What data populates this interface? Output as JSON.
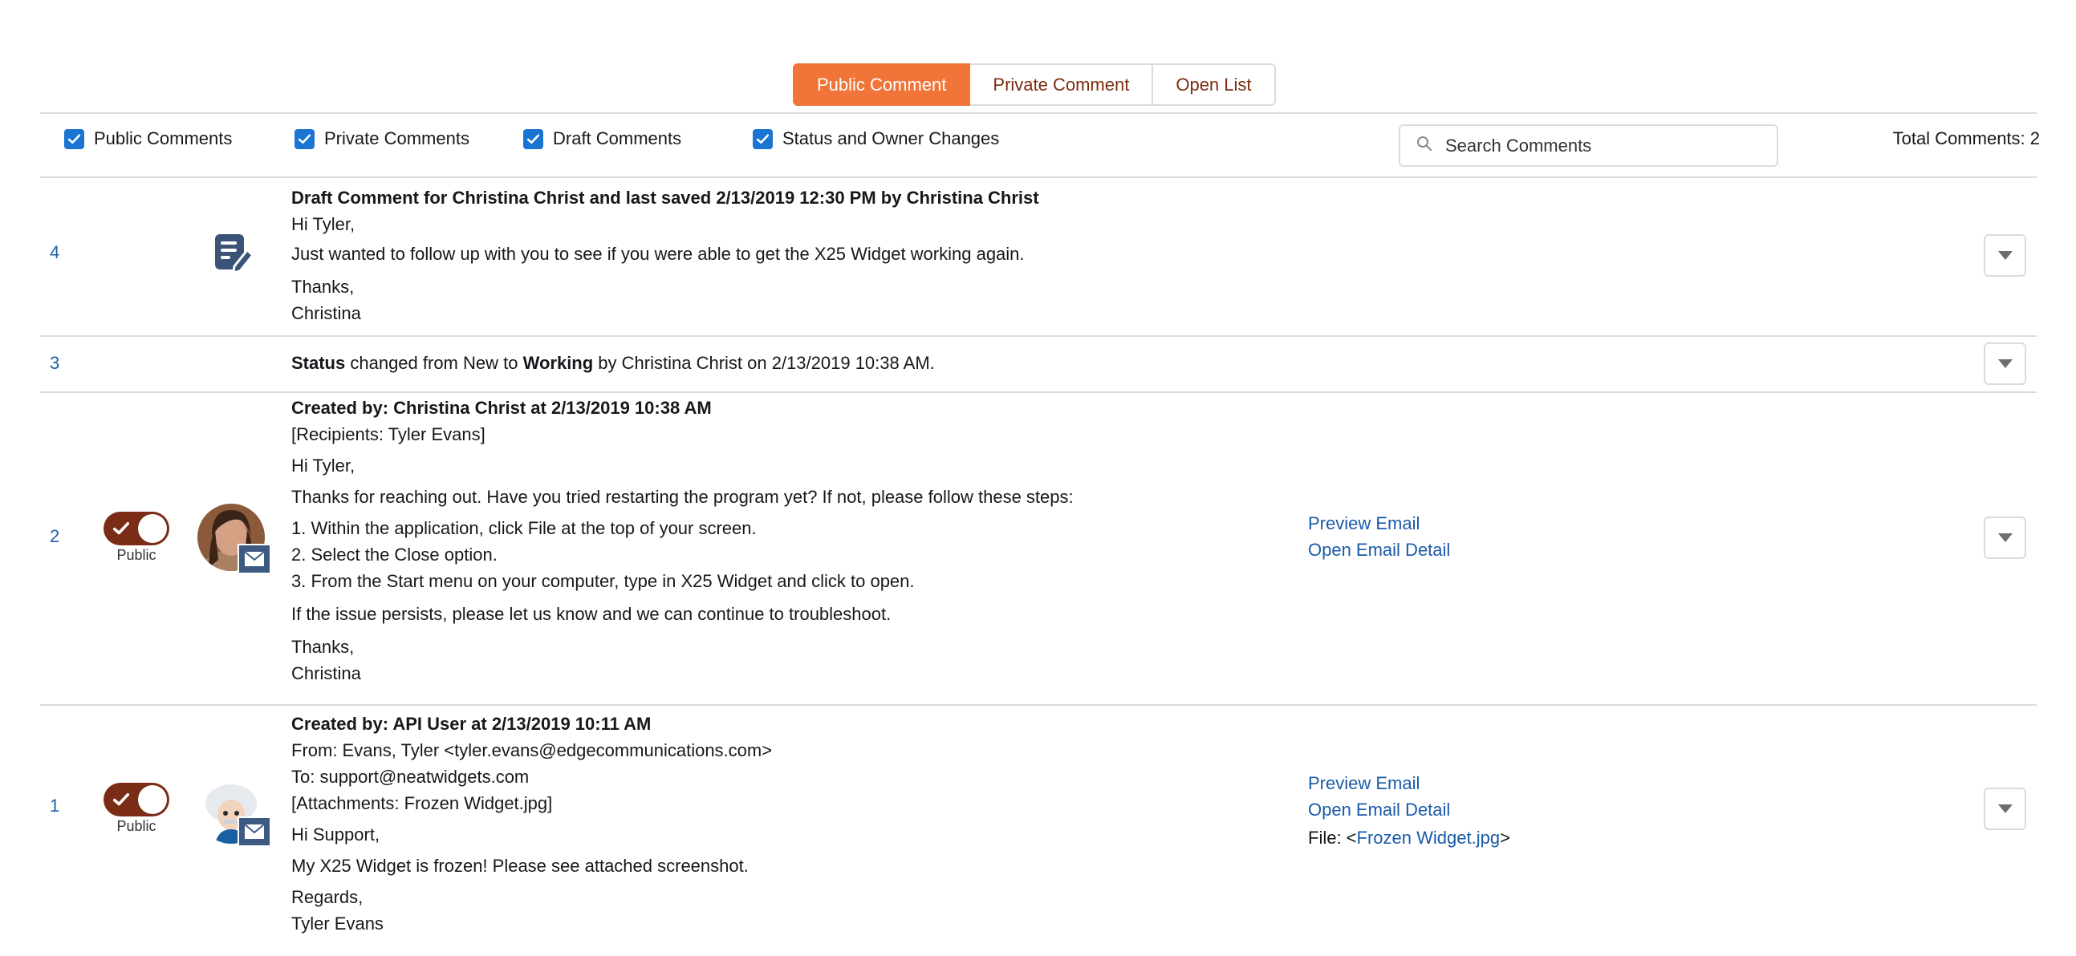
{
  "tabs": [
    {
      "label": "Public Comment",
      "active": true
    },
    {
      "label": "Private Comment",
      "active": false
    },
    {
      "label": "Open List",
      "active": false
    }
  ],
  "filters": [
    {
      "label": "Public Comments",
      "checked": true
    },
    {
      "label": "Private Comments",
      "checked": true
    },
    {
      "label": "Draft Comments",
      "checked": true
    },
    {
      "label": "Status and Owner Changes",
      "checked": true
    }
  ],
  "search": {
    "placeholder": "Search Comments"
  },
  "total_comments": "Total Comments: 2",
  "accent_color": "#f17438",
  "link_color": "#1a5aa8",
  "rows": [
    {
      "number": "4",
      "icon": "draft-note-icon",
      "header": "Draft Comment for Christina Christ and last saved 2/13/2019 12:30 PM by Christina Christ",
      "lines": [
        "Hi Tyler,",
        "Just wanted to follow up with you to see if you were able to get the X25 Widget working again.",
        "Thanks,",
        "Christina"
      ]
    },
    {
      "number": "3",
      "status_label": "Status",
      "status_text_1": " changed from New to ",
      "status_value": "Working",
      "status_text_2": " by Christina Christ on 2/13/2019 10:38 AM."
    },
    {
      "number": "2",
      "toggle_label": "Public",
      "toggle_on": true,
      "header": "Created by: Christina Christ at 2/13/2019 10:38 AM",
      "lines": [
        "[Recipients: Tyler Evans]",
        "Hi Tyler,",
        "Thanks for reaching out. Have you tried restarting the program yet? If not, please follow these steps:",
        "1. Within the application, click File at the top of your screen.",
        "2. Select the Close option.",
        "3. From the Start menu on your computer, type in X25 Widget and click to open.",
        "If the issue persists, please let us know and we can continue to troubleshoot.",
        "Thanks,",
        "Christina"
      ],
      "links": [
        "Preview Email",
        "Open Email Detail"
      ]
    },
    {
      "number": "1",
      "toggle_label": "Public",
      "toggle_on": true,
      "header": "Created by: API User at 2/13/2019 10:11 AM",
      "lines": [
        "From: Evans, Tyler <tyler.evans@edgecommunications.com>",
        "To: support@neatwidgets.com",
        "[Attachments: Frozen Widget.jpg]",
        "Hi Support,",
        "My X25 Widget is frozen! Please see attached screenshot.",
        "Regards,",
        "Tyler Evans"
      ],
      "links": [
        "Preview Email",
        "Open Email Detail"
      ],
      "file_prefix": "File: <",
      "file_name": "Frozen Widget.jpg",
      "file_suffix": ">"
    }
  ]
}
